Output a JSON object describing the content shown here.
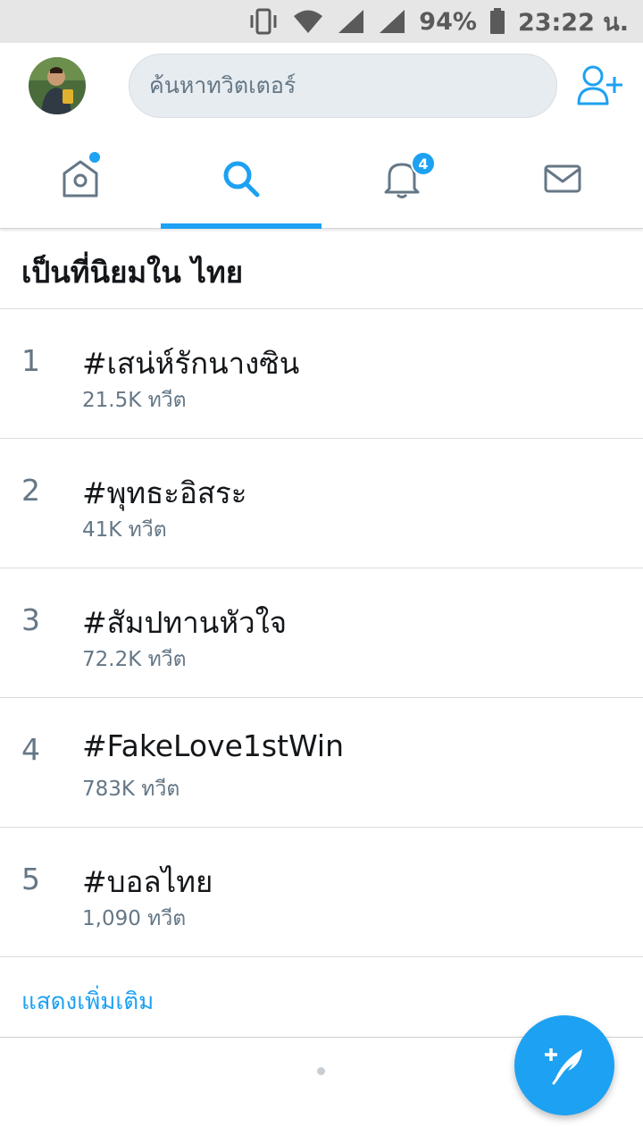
{
  "status_bar": {
    "battery": "94%",
    "time": "23:22 น.",
    "icons": [
      "vibrate-icon",
      "wifi-icon",
      "signal-icon",
      "signal-icon",
      "battery-icon"
    ]
  },
  "header": {
    "search_placeholder": "ค้นหาทวิตเตอร์",
    "icons": [
      "avatar",
      "add-user-icon"
    ]
  },
  "tabs": {
    "items": [
      {
        "icon": "home-icon",
        "has_dot": true
      },
      {
        "icon": "search-icon",
        "active": true
      },
      {
        "icon": "bell-icon",
        "badge": "4"
      },
      {
        "icon": "mail-icon"
      }
    ],
    "accent": "#1da1f2"
  },
  "trends": {
    "title": "เป็นที่นิยมใน ไทย",
    "items": [
      {
        "rank": "1",
        "name": "#เสน่ห์รักนางซิน",
        "count": "21.5K ทวีต"
      },
      {
        "rank": "2",
        "name": "#พุทธะอิสระ",
        "count": "41K ทวีต"
      },
      {
        "rank": "3",
        "name": "#สัมปทานหัวใจ",
        "count": "72.2K ทวีต"
      },
      {
        "rank": "4",
        "name": "#FakeLove1stWin",
        "count": "783K ทวีต"
      },
      {
        "rank": "5",
        "name": "#บอลไทย",
        "count": "1,090 ทวีต"
      }
    ],
    "show_more": "แสดงเพิ่มเติม"
  },
  "fab": {
    "icon": "compose-tweet-icon"
  },
  "colors": {
    "accent": "#1da1f2",
    "secondary_text": "#657786",
    "primary_text": "#14171a"
  }
}
